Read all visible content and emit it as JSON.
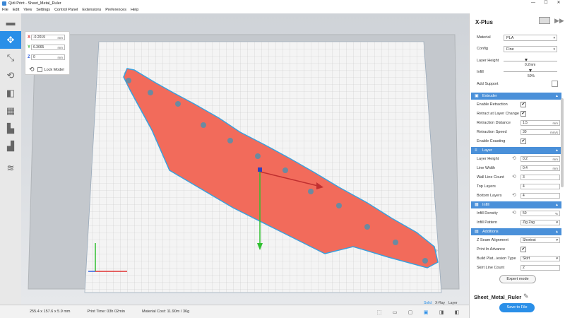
{
  "window": {
    "title": "Qidi Print - Sheet_Metal_Ruler",
    "minimize": "—",
    "maximize": "☐",
    "close": "✕"
  },
  "menu": [
    "File",
    "Edit",
    "View",
    "Settings",
    "Control Panel",
    "Extensions",
    "Preferences",
    "Help"
  ],
  "tools": [
    {
      "name": "open-folder-icon",
      "glyph": "▬"
    },
    {
      "name": "move-icon",
      "glyph": "✥"
    },
    {
      "name": "scale-icon",
      "glyph": "⤡"
    },
    {
      "name": "rotate-icon",
      "glyph": "⟲"
    },
    {
      "name": "mirror-icon",
      "glyph": "◧"
    },
    {
      "name": "per-model-settings-icon",
      "glyph": "▦"
    },
    {
      "name": "support-blocker-icon",
      "glyph": "▙"
    },
    {
      "name": "layer-view-icon",
      "glyph": "▟"
    },
    {
      "name": "wifi-icon",
      "glyph": "≋"
    }
  ],
  "move_panel": {
    "x": {
      "axis": "X",
      "value": "-0.2019",
      "unit": "mm",
      "color": "#e03030"
    },
    "y": {
      "axis": "Y",
      "value": "6.3665",
      "unit": "mm",
      "color": "#30b030"
    },
    "z": {
      "axis": "Z",
      "value": "0",
      "unit": "mm",
      "color": "#3060e0"
    },
    "lock_label": "Lock Model"
  },
  "status": {
    "dimensions": "255.4 x 157.6 x 5.9 mm",
    "print_time": "Print Time: 03h 02min",
    "material_cost": "Material Cost: 11.90m / 36g"
  },
  "view_modes": [
    {
      "label": "Solid",
      "active": true
    },
    {
      "label": "X-Ray",
      "active": false
    },
    {
      "label": "Layer",
      "active": false
    }
  ],
  "right_panel": {
    "printer": "X-Plus",
    "material_label": "Material",
    "material_value": "PLA",
    "config_label": "Config",
    "config_value": "Fine",
    "layer_height_label": "Layer Height",
    "layer_height_value": "0.2mm",
    "layer_height_fraction": 0.42,
    "infill_label": "Infill",
    "infill_value": "50%",
    "infill_fraction": 0.5,
    "support_label": "Add Support",
    "sections": {
      "extruder": "Extruder",
      "layer": "Layer",
      "infill": "Infill",
      "additions": "Additions"
    },
    "extruder": {
      "enable_retraction": "Enable Retraction",
      "retract_layer_change": "Retract at Layer Change",
      "retraction_distance": "Retraction Distance",
      "retraction_distance_value": "1.5",
      "retraction_distance_unit": "mm",
      "retraction_speed": "Retraction Speed",
      "retraction_speed_value": "30",
      "retraction_speed_unit": "mm/s",
      "enable_coasting": "Enable Coasting"
    },
    "layer": {
      "layer_height": "Layer Height",
      "layer_height_value": "0.2",
      "layer_height_unit": "mm",
      "line_width": "Line Width",
      "line_width_value": "0.4",
      "line_width_unit": "mm",
      "wall_line_count": "Wall Line Count",
      "wall_line_count_value": "3",
      "top_layers": "Top Layers",
      "top_layers_value": "4",
      "bottom_layers": "Bottom Layers",
      "bottom_layers_value": "4"
    },
    "infill": {
      "infill_density": "Infill Density",
      "infill_density_value": "50",
      "infill_density_unit": "%",
      "infill_pattern": "Infill Pattern",
      "infill_pattern_value": "Zig Zag"
    },
    "additions": {
      "z_seam": "Z Seam Alignment",
      "z_seam_value": "Shortest",
      "print_in_advance": "Print In Advance",
      "adhesion_type": "Build Plat...iesion Type",
      "adhesion_type_value": "Skirt",
      "skirt_line_count": "Skirt Line Count",
      "skirt_line_count_value": "2"
    },
    "expert_mode": "Expert mode",
    "file_name": "Sheet_Metal_Ruler",
    "save_label": "Save to File"
  }
}
